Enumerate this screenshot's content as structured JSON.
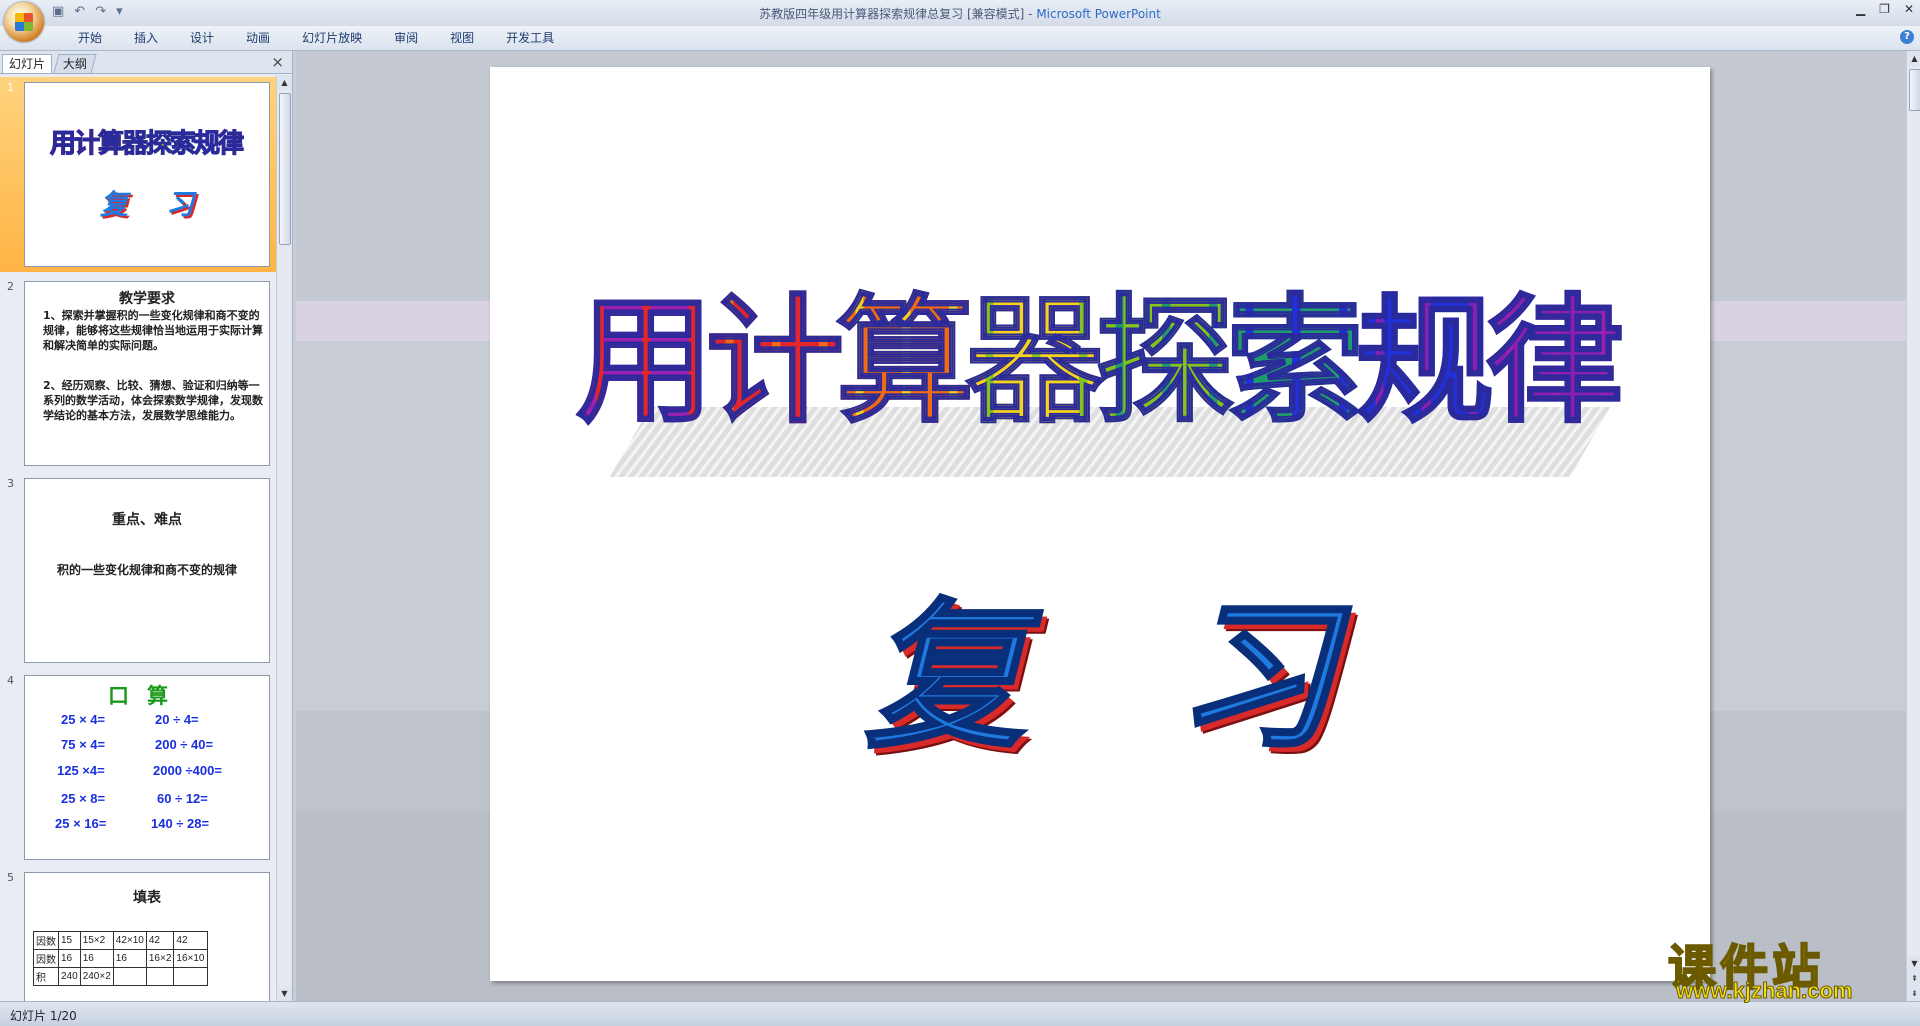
{
  "window": {
    "title": "苏教版四年级用计算器探索规律总复习 [兼容模式]",
    "app_name": "Microsoft PowerPoint",
    "separator": " - "
  },
  "quick_access": {
    "save_icon": "save-icon",
    "undo_icon": "undo-icon",
    "redo_icon": "redo-icon",
    "dropdown": "▾"
  },
  "ribbon": {
    "tabs": [
      "开始",
      "插入",
      "设计",
      "动画",
      "幻灯片放映",
      "审阅",
      "视图",
      "开发工具"
    ],
    "help": "?"
  },
  "pane": {
    "tab_slides": "幻灯片",
    "tab_outline": "大纲",
    "close": "×"
  },
  "slides": {
    "nums": [
      "1",
      "2",
      "3",
      "4",
      "5"
    ],
    "s1": {
      "title": [
        "用",
        "计",
        "算",
        "器",
        "探",
        "索",
        "规",
        "律"
      ],
      "sub": [
        "复",
        "习"
      ]
    },
    "s2": {
      "head": "教学要求",
      "p1": "1、探索并掌握积的一些变化规律和商不变的规律，能够将这些规律恰当地运用于实际计算和解决简单的实际问题。",
      "p2": "2、经历观察、比较、猜想、验证和归纳等一系列的数学活动，体会探索数学规律，发现数学结论的基本方法，发展数学思维能力。"
    },
    "s3": {
      "head": "重点、难点",
      "body": "积的一些变化规律和商不变的规律"
    },
    "s4": {
      "head": "口算",
      "left": [
        "25 × 4=",
        "75 × 4=",
        "125 ×4=",
        "25 × 8=",
        "25 × 16="
      ],
      "right": [
        "20 ÷ 4=",
        "200 ÷ 40=",
        "2000 ÷400=",
        "60 ÷ 12=",
        "140 ÷ 28="
      ]
    },
    "s5": {
      "head": "填表",
      "rows": [
        [
          "因数",
          "15",
          "15×2",
          "42×10",
          "42",
          "42"
        ],
        [
          "因数",
          "16",
          "16",
          "16",
          "16×2",
          "16×10"
        ],
        [
          "积",
          "240",
          "240×2",
          "",
          "",
          ""
        ]
      ]
    }
  },
  "main_slide": {
    "title": [
      "用",
      "计",
      "算",
      "器",
      "探",
      "索",
      "规",
      "律"
    ],
    "subtitle": [
      "复",
      "习"
    ]
  },
  "status": {
    "text": "幻灯片 1/20"
  },
  "watermark": {
    "text": "课件站",
    "url": "www.kjzhan.com"
  },
  "colors": {
    "rainbow": [
      "#9b1fb0",
      "#e2262c",
      "#f06a12",
      "#f7d21a",
      "#84c31c",
      "#1f9a6a",
      "#2230d8",
      "#8a1fb0"
    ],
    "selected_thumb": "#ffb444",
    "subtitle_blue": "#1f7ae0"
  }
}
